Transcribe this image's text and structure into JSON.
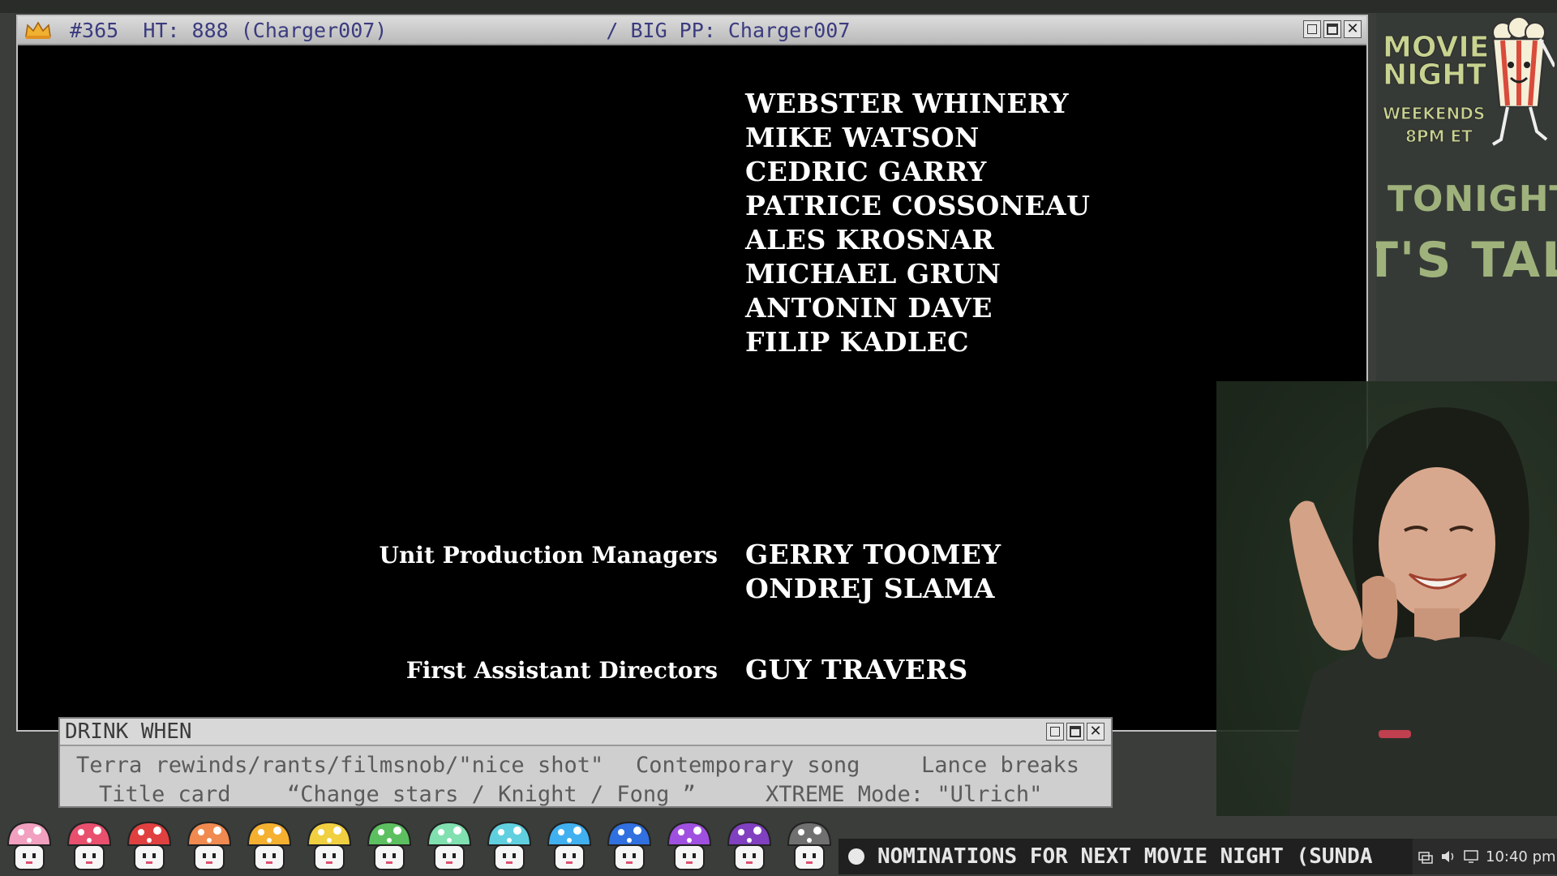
{
  "video_window": {
    "title_rank": "#365",
    "title_high": "HT: 888 (Charger007)",
    "title_big": "/ BIG PP: Charger007"
  },
  "credits": {
    "names_block_1": [
      "WEBSTER WHINERY",
      "MIKE WATSON",
      "CEDRIC GARRY",
      "PATRICE COSSONEAU",
      "ALES KROSNAR",
      "MICHAEL GRUN",
      "ANTONIN DAVE",
      "FILIP KADLEC"
    ],
    "role_upm": "Unit Production Managers",
    "names_upm": [
      "GERRY TOOMEY",
      "ONDREJ SLAMA"
    ],
    "role_fad": "First Assistant Directors",
    "names_fad": [
      "GUY TRAVERS"
    ]
  },
  "side_panel": {
    "logo_line1": "MOVIE",
    "logo_line2": "NIGHT",
    "logo_line3": "WEEKENDS",
    "logo_line4": "8PM ET",
    "tonight_label": "TONIGHT:",
    "tonight_title": "T'S TALI"
  },
  "drink_window": {
    "title": "DRINK WHEN",
    "items": [
      "Terra rewinds/rants/filmsnob/\"nice shot\"",
      "Contemporary song",
      "Lance breaks",
      "Title card",
      "“Change stars / Knight / Fong ”",
      "XTREME Mode: \"Ulrich\""
    ]
  },
  "taskbar": {
    "ticker": "NOMINATIONS FOR NEXT MOVIE NIGHT (SUNDA",
    "clock": "10:40 pm",
    "badge_colors": [
      "#f2a0c0",
      "#e8506e",
      "#e04040",
      "#f08a50",
      "#f5b030",
      "#f0d040",
      "#5cc060",
      "#80e0b0",
      "#60d0e0",
      "#40b0f0",
      "#3070e0",
      "#a050e0",
      "#8040c0",
      "#707070"
    ],
    "badge_names": [
      "rainbow-mushroom-badge",
      "pink-heart-badge",
      "red-mushroom-badge",
      "orange-mushroom-badge",
      "amber-mushroom-badge",
      "yellow-mushroom-badge",
      "green-mushroom-badge",
      "mint-mushroom-badge",
      "cyan-mushroom-badge",
      "sky-mushroom-badge",
      "blue-mushroom-badge",
      "violet-mushroom-badge",
      "purple-mushroom-badge",
      "black-mushroom-badge"
    ]
  }
}
